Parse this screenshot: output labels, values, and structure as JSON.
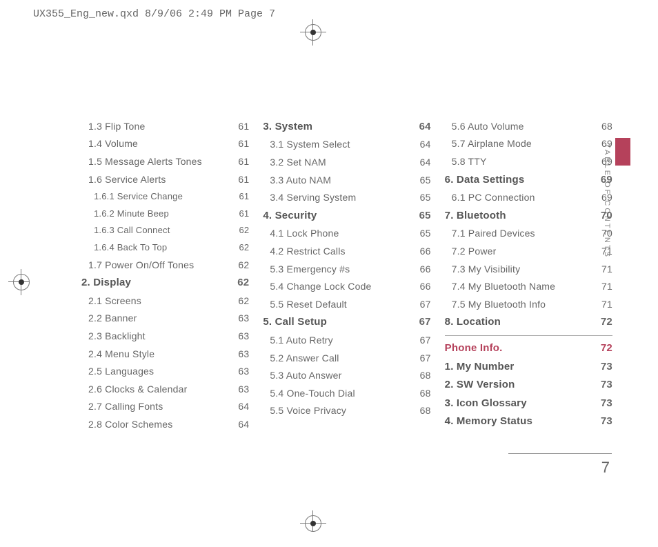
{
  "header": "UX355_Eng_new.qxd  8/9/06  2:49 PM  Page 7",
  "side_label": "TABLE OF CONTENTS",
  "page_number": "7",
  "col1": [
    {
      "label": "1.3 Flip Tone",
      "pg": "61",
      "lvl": 2
    },
    {
      "label": "1.4 Volume",
      "pg": "61",
      "lvl": 2
    },
    {
      "label": "1.5 Message Alerts Tones",
      "pg": "61",
      "lvl": 2
    },
    {
      "label": "1.6 Service Alerts",
      "pg": "61",
      "lvl": 2
    },
    {
      "label": "1.6.1 Service Change",
      "pg": "61",
      "lvl": 3
    },
    {
      "label": "1.6.2 Minute Beep",
      "pg": "61",
      "lvl": 3
    },
    {
      "label": "1.6.3 Call Connect",
      "pg": "62",
      "lvl": 3
    },
    {
      "label": "1.6.4 Back To Top",
      "pg": "62",
      "lvl": 3
    },
    {
      "label": "1.7 Power On/Off Tones",
      "pg": "62",
      "lvl": 2
    },
    {
      "label": "2. Display",
      "pg": "62",
      "lvl": 1,
      "section": true
    },
    {
      "label": "2.1 Screens",
      "pg": "62",
      "lvl": 2
    },
    {
      "label": "2.2 Banner",
      "pg": "63",
      "lvl": 2
    },
    {
      "label": "2.3 Backlight",
      "pg": "63",
      "lvl": 2
    },
    {
      "label": "2.4 Menu Style",
      "pg": "63",
      "lvl": 2
    },
    {
      "label": "2.5 Languages",
      "pg": "63",
      "lvl": 2
    },
    {
      "label": "2.6 Clocks & Calendar",
      "pg": "63",
      "lvl": 2
    },
    {
      "label": "2.7 Calling Fonts",
      "pg": "64",
      "lvl": 2
    },
    {
      "label": "2.8 Color Schemes",
      "pg": "64",
      "lvl": 2
    }
  ],
  "col2": [
    {
      "label": "3. System",
      "pg": "64",
      "lvl": 1,
      "section": true
    },
    {
      "label": "3.1 System Select",
      "pg": "64",
      "lvl": 2
    },
    {
      "label": "3.2 Set NAM",
      "pg": "64",
      "lvl": 2
    },
    {
      "label": "3.3 Auto NAM",
      "pg": "65",
      "lvl": 2
    },
    {
      "label": "3.4 Serving System",
      "pg": "65",
      "lvl": 2
    },
    {
      "label": "4. Security",
      "pg": "65",
      "lvl": 1,
      "section": true
    },
    {
      "label": "4.1 Lock Phone",
      "pg": "65",
      "lvl": 2
    },
    {
      "label": "4.2 Restrict Calls",
      "pg": "66",
      "lvl": 2
    },
    {
      "label": "5.3 Emergency #s",
      "pg": "66",
      "lvl": 2
    },
    {
      "label": "5.4 Change Lock Code",
      "pg": "66",
      "lvl": 2
    },
    {
      "label": "5.5 Reset Default",
      "pg": "67",
      "lvl": 2
    },
    {
      "label": "5. Call Setup",
      "pg": "67",
      "lvl": 1,
      "section": true
    },
    {
      "label": "5.1 Auto Retry",
      "pg": "67",
      "lvl": 2
    },
    {
      "label": "5.2 Answer Call",
      "pg": "67",
      "lvl": 2
    },
    {
      "label": "5.3 Auto Answer",
      "pg": "68",
      "lvl": 2
    },
    {
      "label": "5.4 One-Touch Dial",
      "pg": "68",
      "lvl": 2
    },
    {
      "label": "5.5 Voice Privacy",
      "pg": "68",
      "lvl": 2
    }
  ],
  "col3": [
    {
      "label": "5.6 Auto Volume",
      "pg": "68",
      "lvl": 2
    },
    {
      "label": "5.7 Airplane Mode",
      "pg": "69",
      "lvl": 2
    },
    {
      "label": "5.8 TTY",
      "pg": "69",
      "lvl": 2
    },
    {
      "label": "6. Data Settings",
      "pg": "69",
      "lvl": 1,
      "section": true
    },
    {
      "label": "6.1 PC Connection",
      "pg": "69",
      "lvl": 2
    },
    {
      "label": "7. Bluetooth",
      "pg": "70",
      "lvl": 1,
      "section": true
    },
    {
      "label": "7.1 Paired Devices",
      "pg": "70",
      "lvl": 2
    },
    {
      "label": "7.2 Power",
      "pg": "71",
      "lvl": 2
    },
    {
      "label": "7.3 My Visibility",
      "pg": "71",
      "lvl": 2
    },
    {
      "label": "7.4 My Bluetooth Name",
      "pg": "71",
      "lvl": 2
    },
    {
      "label": "7.5 My Bluetooth Info",
      "pg": "71",
      "lvl": 2
    },
    {
      "label": "8. Location",
      "pg": "72",
      "lvl": 1,
      "section": true
    },
    {
      "rule": true
    },
    {
      "label": "Phone Info.",
      "pg": "72",
      "lvl": 1,
      "pink": true
    },
    {
      "label": "1. My Number",
      "pg": "73",
      "lvl": 1,
      "section": true
    },
    {
      "label": "2. SW Version",
      "pg": "73",
      "lvl": 1,
      "section": true
    },
    {
      "label": "3. Icon Glossary",
      "pg": "73",
      "lvl": 1,
      "section": true
    },
    {
      "label": "4. Memory Status",
      "pg": "73",
      "lvl": 1,
      "section": true
    }
  ]
}
